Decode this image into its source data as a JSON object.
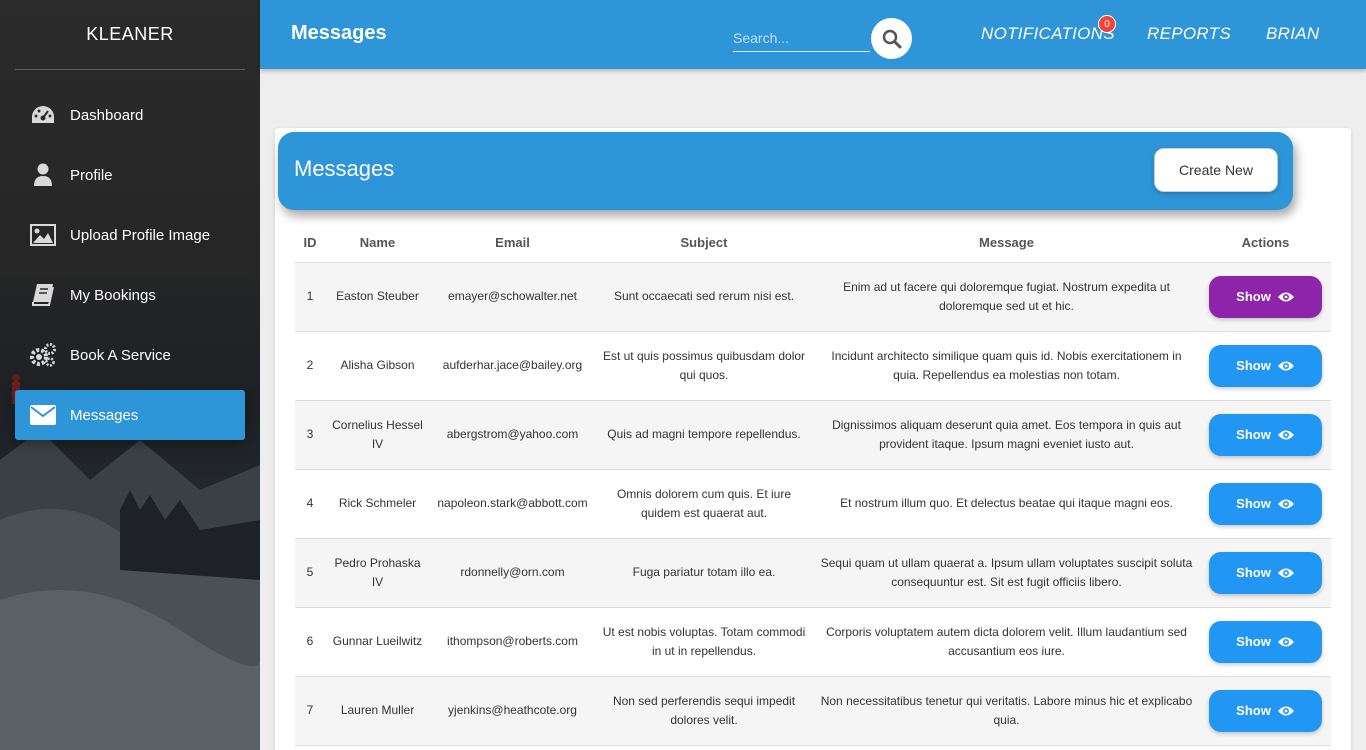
{
  "brand": "KLEANER",
  "sidebar": {
    "items": [
      {
        "label": "Dashboard",
        "icon": "dashboard-gauge-icon",
        "active": false
      },
      {
        "label": "Profile",
        "icon": "user-icon",
        "active": false
      },
      {
        "label": "Upload Profile Image",
        "icon": "image-icon",
        "active": false
      },
      {
        "label": "My Bookings",
        "icon": "book-icon",
        "active": false
      },
      {
        "label": "Book A Service",
        "icon": "gears-icon",
        "active": false
      },
      {
        "label": "Messages",
        "icon": "envelope-icon",
        "active": true
      }
    ]
  },
  "topbar": {
    "title": "Messages",
    "search_placeholder": "Search...",
    "notifications_label": "NOTIFICATIONS",
    "notifications_count": "0",
    "reports_label": "REPORTS",
    "user_label": "BRIAN"
  },
  "card": {
    "title": "Messages",
    "create_label": "Create New"
  },
  "table": {
    "headers": [
      "ID",
      "Name",
      "Email",
      "Subject",
      "Message",
      "Actions"
    ],
    "show_label": "Show",
    "rows": [
      {
        "id": "1",
        "name": "Easton Steuber",
        "email": "emayer@schowalter.net",
        "subject": "Sunt occaecati sed rerum nisi est.",
        "message": "Enim ad ut facere qui doloremque fugiat. Nostrum expedita ut doloremque sed ut et hic."
      },
      {
        "id": "2",
        "name": "Alisha Gibson",
        "email": "aufderhar.jace@bailey.org",
        "subject": "Est ut quis possimus quibusdam dolor qui quos.",
        "message": "Incidunt architecto similique quam quis id. Nobis exercitationem in quia. Repellendus ea molestias non totam."
      },
      {
        "id": "3",
        "name": "Cornelius Hessel IV",
        "email": "abergstrom@yahoo.com",
        "subject": "Quis ad magni tempore repellendus.",
        "message": "Dignissimos aliquam deserunt quia amet. Eos tempora in quis aut provident itaque. Ipsum magni eveniet iusto aut."
      },
      {
        "id": "4",
        "name": "Rick Schmeler",
        "email": "napoleon.stark@abbott.com",
        "subject": "Omnis dolorem cum quis. Et iure quidem est quaerat aut.",
        "message": "Et nostrum illum quo. Et delectus beatae qui itaque magni eos."
      },
      {
        "id": "5",
        "name": "Pedro Prohaska IV",
        "email": "rdonnelly@orn.com",
        "subject": "Fuga pariatur totam illo ea.",
        "message": "Sequi quam ut ullam quaerat a. Ipsum ullam voluptates suscipit soluta consequuntur est. Sit est fugit officiis libero."
      },
      {
        "id": "6",
        "name": "Gunnar Lueilwitz",
        "email": "ithompson@roberts.com",
        "subject": "Ut est nobis voluptas. Totam commodi in ut in repellendus.",
        "message": "Corporis voluptatem autem dicta dolorem velit. Illum laudantium sed accusantium eos iure."
      },
      {
        "id": "7",
        "name": "Lauren Muller",
        "email": "yjenkins@heathcote.org",
        "subject": "Non sed perferendis sequi impedit dolores velit.",
        "message": "Non necessitatibus tenetur qui veritatis. Labore minus hic et explicabo quia."
      }
    ]
  },
  "colors": {
    "primary": "#2d95d8",
    "button": "#2196f3",
    "button_active": "#8e24aa",
    "badge": "#f44336"
  }
}
